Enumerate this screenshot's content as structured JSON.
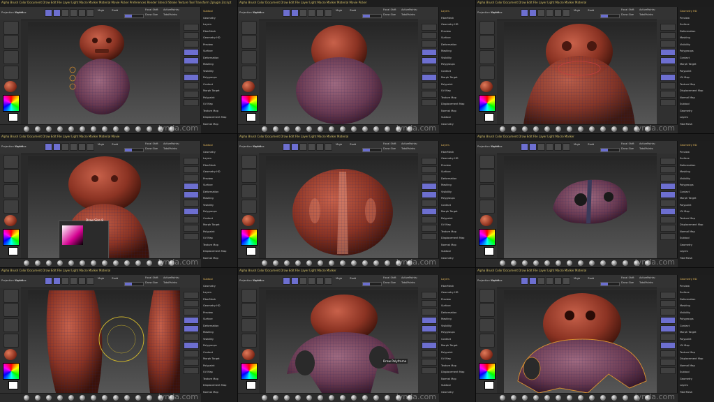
{
  "app": {
    "watermark": "lynda.com"
  },
  "menu": {
    "p1": "Alpha  Brush  Color  Document  Draw  Edit  File  Layer  Light  Macro  Marker  Material  Movie  Picker  Preferences  Render  Stencil  Stroke  Texture  Tool  Transform  Zplugin  Zscript",
    "p2": "Alpha  Brush  Color  Document  Draw  Edit  File  Layer  Light  Macro  Marker  Material  Movie  Picker",
    "p3": "Alpha  Brush  Color  Document  Draw  Edit  File  Layer  Light  Macro  Marker  Material",
    "p4": "Alpha  Brush  Color  Document  Draw  Edit  File  Layer  Light  Macro  Marker  Material  Movie",
    "p5": "Alpha  Brush  Color  Document  Draw  Edit  File  Layer  Light  Macro  Marker  Material",
    "p6": "Alpha  Brush  Color  Document  Draw  Edit  File  Layer  Light  Macro  Marker",
    "p7": "Alpha  Brush  Color  Document  Draw  Edit  File  Layer  Light  Macro  Marker  Material",
    "p8": "Alpha  Brush  Color  Document  Draw  Edit  File  Layer  Light  Macro  Marker",
    "p9": "Alpha  Brush  Color  Document  Draw  Edit  File  Layer  Light  Macro  Marker  Material"
  },
  "toolbar": {
    "projection": "Projection Master",
    "lightbox": "LightBox",
    "quicksketch": "Quick Sketch",
    "edit": "Edit",
    "draw": "Draw",
    "move": "Move",
    "scale": "Scale",
    "rotate": "Rotate",
    "mrgb": "Mrgb",
    "rgb": "Rgb",
    "m": "M",
    "zadd": "Zadd",
    "zsub": "Zsub",
    "focal": "Focal Shift",
    "drawsize": "Draw Size",
    "rgbintensity": "Rgb Intensity",
    "zintensity": "Z Intensity",
    "focal_value": "0",
    "drawsize_value": "64",
    "zintensity_value": "25",
    "active_points": "ActivePoints:",
    "total_points": "TotalPoints:"
  },
  "tray": {
    "items": [
      "Subtool",
      "Geometry",
      "Layers",
      "FiberMesh",
      "Geometry HD",
      "Preview",
      "Surface",
      "Deformation",
      "Masking",
      "Visibility",
      "Polygroups",
      "Contact",
      "Morph Target",
      "Polypaint",
      "UV Map",
      "Texture Map",
      "Displacement Map",
      "Normal Map"
    ],
    "brush_label": "Draw Size",
    "dynamic": "Dynamic",
    "radial": "Radial"
  },
  "popups": {
    "draw_size": "Draw Size  8",
    "draw_polyframe": "Draw Polyframe"
  }
}
